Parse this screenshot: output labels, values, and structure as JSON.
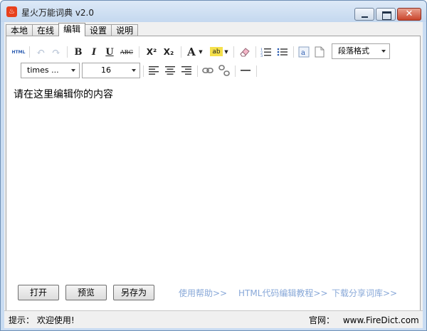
{
  "window": {
    "title": "星火万能词典 v2.0",
    "close_glyph": "✕"
  },
  "tabs": [
    {
      "label": "本地"
    },
    {
      "label": "在线"
    },
    {
      "label": "编辑",
      "active": true
    },
    {
      "label": "设置"
    },
    {
      "label": "说明"
    }
  ],
  "toolbar": {
    "html_label": "HTML",
    "bold": "B",
    "italic": "I",
    "underline": "U",
    "strike": "ABC",
    "superscript": "X²",
    "subscript": "X₂",
    "font_color": "A",
    "highlight": "ab",
    "paragraph_format": "段落格式",
    "font_family": "times ...",
    "font_size": "16",
    "icons": [
      "html-source-icon",
      "undo-icon",
      "redo-icon",
      "bold-icon",
      "italic-icon",
      "underline-icon",
      "strikethrough-icon",
      "superscript-icon",
      "subscript-icon",
      "font-color-icon",
      "highlight-icon",
      "eraser-icon",
      "ordered-list-icon",
      "unordered-list-icon",
      "special-char-icon",
      "page-icon",
      "align-left-icon",
      "align-center-icon",
      "align-right-icon",
      "link-icon",
      "unlink-icon",
      "horizontal-rule-icon"
    ]
  },
  "editor": {
    "content": "请在这里编辑你的内容"
  },
  "actions": {
    "open": "打开",
    "preview": "预览",
    "save_as": "另存为"
  },
  "links": {
    "help": "使用帮助>>",
    "html_tutorial": "HTML代码编辑教程>>",
    "download_share": "下载分享词库>>"
  },
  "status": {
    "hint_label": "提示：",
    "hint_text": "欢迎使用!",
    "site_label": "官网：",
    "site_url": "www.FireDict.com"
  },
  "colors": {
    "title_bar": "#c9dcf2",
    "link": "#88a8d8",
    "close_button": "#c9452c"
  }
}
